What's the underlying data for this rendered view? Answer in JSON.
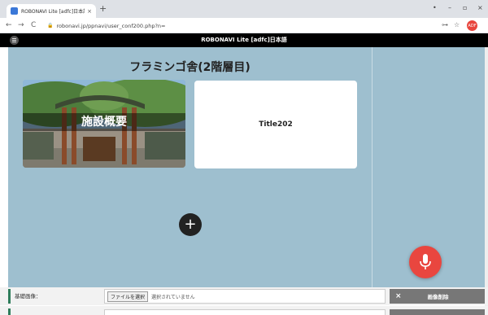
{
  "browser": {
    "tab_title": "ROBONAVI Lite [adfc]日本語",
    "tab_close": "×",
    "new_tab": "+",
    "url": "robonavi.jp/ppnavi/user_conf200.php?n=",
    "win_controls": [
      "•",
      "–",
      "▫",
      "×"
    ],
    "nav_icons": [
      "←",
      "→",
      "C"
    ],
    "addr_icons": [
      "⊶",
      "☆"
    ],
    "profile": "ADF"
  },
  "header": {
    "title": "ROBONAVI Lite [adfc]日本語"
  },
  "main": {
    "heading": "フラミンゴ舎(2階層目)",
    "cards": [
      {
        "label": "施設概要"
      },
      {
        "label": "Title202"
      }
    ],
    "add_button": "+"
  },
  "form": {
    "label": "基礎画像：",
    "file_button": "ファイルを選択",
    "file_status": "選択されていません",
    "clear_x": "×",
    "clear_label": "画像削除"
  },
  "colors": {
    "background": "#9ebfcf",
    "mic": "#e9463f",
    "header": "#000000",
    "accent": "#2e7d5b"
  }
}
